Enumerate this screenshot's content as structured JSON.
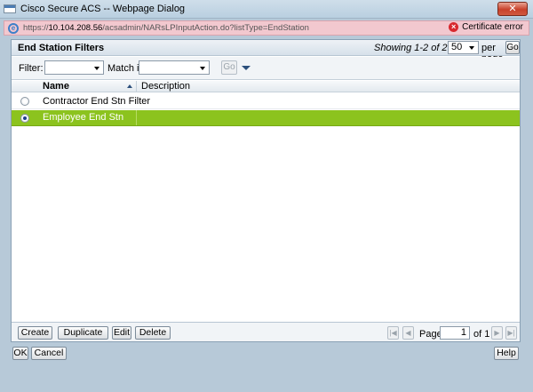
{
  "window": {
    "title": "Cisco Secure ACS -- Webpage Dialog",
    "close_label": "✕"
  },
  "address_bar": {
    "url_prefix": "https://",
    "url_host": "10.104.208.56",
    "url_path": "/acsadmin/NARsLPInputAction.do?listType=EndStation",
    "cert_error_label": "Certificate error"
  },
  "panel": {
    "title": "End Station Filters",
    "showing_text": "Showing 1-2 of 2",
    "per_page_value": "50",
    "per_page_label": "per page",
    "go_label": "Go"
  },
  "filter": {
    "filter_label": "Filter:",
    "match_if_label": "Match if:",
    "go_label": "Go"
  },
  "grid": {
    "columns": [
      {
        "label": "Name"
      },
      {
        "label": "Description"
      }
    ],
    "rows": [
      {
        "name": "Contractor End Stn Filter",
        "description": "",
        "selected": false
      },
      {
        "name": "Employee End Stn Filter",
        "description": "",
        "selected": true
      }
    ]
  },
  "toolbar": {
    "create_label": "Create",
    "duplicate_label": "Duplicate",
    "edit_label": "Edit",
    "delete_label": "Delete"
  },
  "pager": {
    "page_label": "Page",
    "page_value": "1",
    "of_label": "of 1"
  },
  "dialog_buttons": {
    "ok_label": "OK",
    "cancel_label": "Cancel",
    "help_label": "Help"
  },
  "colors": {
    "selected_row": "#8cc31e",
    "close_button": "#c8412b",
    "address_bar_error": "#f2c8cf"
  }
}
